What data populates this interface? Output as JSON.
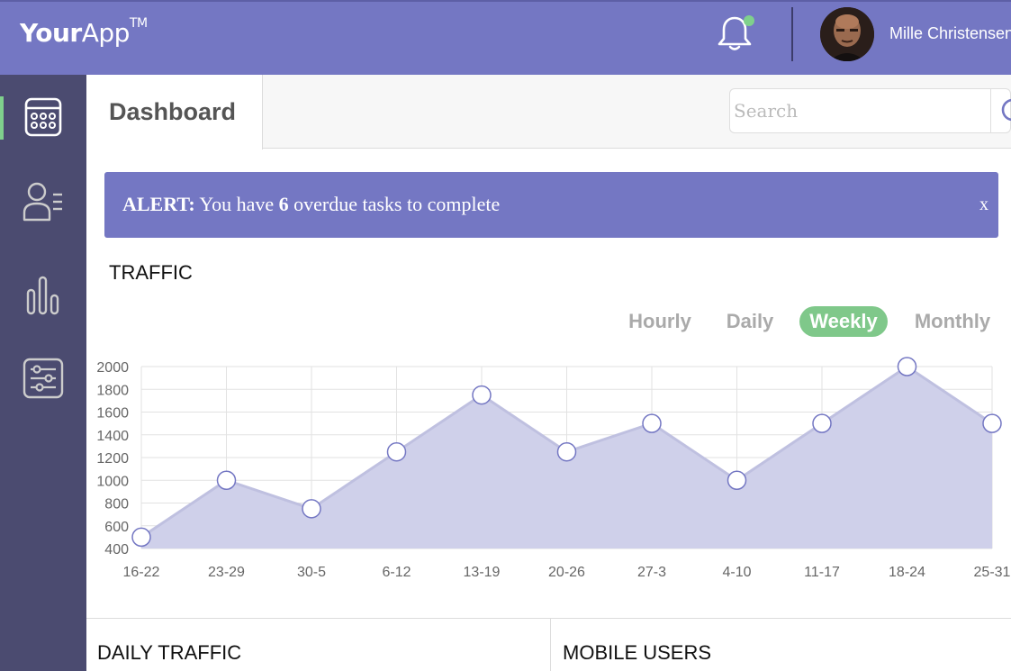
{
  "app": {
    "logo_bold": "Your",
    "logo_light": "App",
    "logo_tm": "TM"
  },
  "header": {
    "username": "Mille Christensen",
    "notification_dot_color": "#7fd08c"
  },
  "sidebar": {
    "items": [
      {
        "icon": "calendar-icon",
        "active": true
      },
      {
        "icon": "users-list-icon",
        "active": false
      },
      {
        "icon": "bar-chart-icon",
        "active": false
      },
      {
        "icon": "sliders-icon",
        "active": false
      }
    ]
  },
  "page": {
    "tab_title": "Dashboard"
  },
  "search": {
    "placeholder": "Search",
    "value": ""
  },
  "alert": {
    "label": "ALERT:",
    "text_before": " You have ",
    "count": "6",
    "text_after": " overdue tasks to complete",
    "close": "x"
  },
  "traffic": {
    "title": "TRAFFIC",
    "periods": [
      "Hourly",
      "Daily",
      "Weekly",
      "Monthly"
    ],
    "active_period": "Weekly"
  },
  "chart_data": {
    "type": "area",
    "categories": [
      "16-22",
      "23-29",
      "30-5",
      "6-12",
      "13-19",
      "20-26",
      "27-3",
      "4-10",
      "11-17",
      "18-24",
      "25-31"
    ],
    "series": [
      {
        "values": [
          500,
          1000,
          750,
          1250,
          1750,
          1250,
          1500,
          1000,
          1500,
          2000,
          1500
        ]
      }
    ],
    "ylim": [
      400,
      2000
    ],
    "yticks": [
      400,
      600,
      800,
      1000,
      1200,
      1400,
      1600,
      1800,
      2000
    ],
    "grid": true,
    "fill_color": "#cfd0ea",
    "line_color": "#bfc0e0",
    "point_stroke": "#7477c3"
  },
  "panels": {
    "daily_title": "DAILY TRAFFIC",
    "mobile_title": "MOBILE USERS"
  },
  "colors": {
    "brand": "#7477c3",
    "sidebar": "#4b4b70",
    "accent": "#7fc88a"
  }
}
